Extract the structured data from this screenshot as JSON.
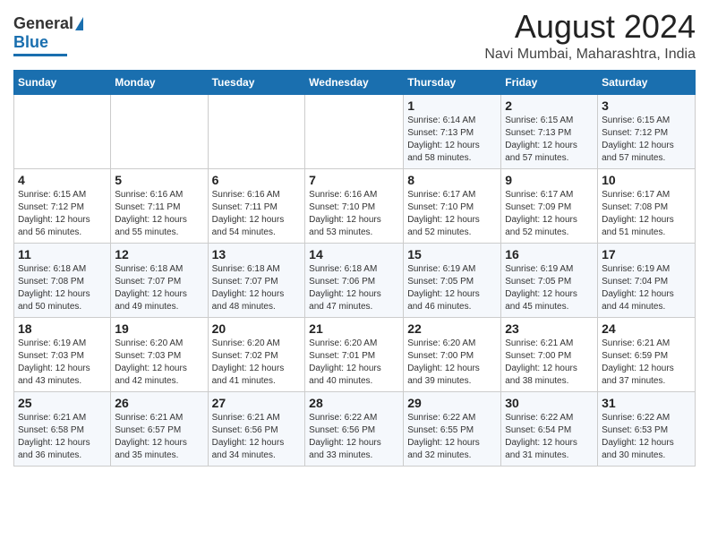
{
  "header": {
    "logo_general": "General",
    "logo_blue": "Blue",
    "main_title": "August 2024",
    "sub_title": "Navi Mumbai, Maharashtra, India"
  },
  "calendar": {
    "weekdays": [
      "Sunday",
      "Monday",
      "Tuesday",
      "Wednesday",
      "Thursday",
      "Friday",
      "Saturday"
    ],
    "weeks": [
      [
        {
          "day": "",
          "info": ""
        },
        {
          "day": "",
          "info": ""
        },
        {
          "day": "",
          "info": ""
        },
        {
          "day": "",
          "info": ""
        },
        {
          "day": "1",
          "info": "Sunrise: 6:14 AM\nSunset: 7:13 PM\nDaylight: 12 hours\nand 58 minutes."
        },
        {
          "day": "2",
          "info": "Sunrise: 6:15 AM\nSunset: 7:13 PM\nDaylight: 12 hours\nand 57 minutes."
        },
        {
          "day": "3",
          "info": "Sunrise: 6:15 AM\nSunset: 7:12 PM\nDaylight: 12 hours\nand 57 minutes."
        }
      ],
      [
        {
          "day": "4",
          "info": "Sunrise: 6:15 AM\nSunset: 7:12 PM\nDaylight: 12 hours\nand 56 minutes."
        },
        {
          "day": "5",
          "info": "Sunrise: 6:16 AM\nSunset: 7:11 PM\nDaylight: 12 hours\nand 55 minutes."
        },
        {
          "day": "6",
          "info": "Sunrise: 6:16 AM\nSunset: 7:11 PM\nDaylight: 12 hours\nand 54 minutes."
        },
        {
          "day": "7",
          "info": "Sunrise: 6:16 AM\nSunset: 7:10 PM\nDaylight: 12 hours\nand 53 minutes."
        },
        {
          "day": "8",
          "info": "Sunrise: 6:17 AM\nSunset: 7:10 PM\nDaylight: 12 hours\nand 52 minutes."
        },
        {
          "day": "9",
          "info": "Sunrise: 6:17 AM\nSunset: 7:09 PM\nDaylight: 12 hours\nand 52 minutes."
        },
        {
          "day": "10",
          "info": "Sunrise: 6:17 AM\nSunset: 7:08 PM\nDaylight: 12 hours\nand 51 minutes."
        }
      ],
      [
        {
          "day": "11",
          "info": "Sunrise: 6:18 AM\nSunset: 7:08 PM\nDaylight: 12 hours\nand 50 minutes."
        },
        {
          "day": "12",
          "info": "Sunrise: 6:18 AM\nSunset: 7:07 PM\nDaylight: 12 hours\nand 49 minutes."
        },
        {
          "day": "13",
          "info": "Sunrise: 6:18 AM\nSunset: 7:07 PM\nDaylight: 12 hours\nand 48 minutes."
        },
        {
          "day": "14",
          "info": "Sunrise: 6:18 AM\nSunset: 7:06 PM\nDaylight: 12 hours\nand 47 minutes."
        },
        {
          "day": "15",
          "info": "Sunrise: 6:19 AM\nSunset: 7:05 PM\nDaylight: 12 hours\nand 46 minutes."
        },
        {
          "day": "16",
          "info": "Sunrise: 6:19 AM\nSunset: 7:05 PM\nDaylight: 12 hours\nand 45 minutes."
        },
        {
          "day": "17",
          "info": "Sunrise: 6:19 AM\nSunset: 7:04 PM\nDaylight: 12 hours\nand 44 minutes."
        }
      ],
      [
        {
          "day": "18",
          "info": "Sunrise: 6:19 AM\nSunset: 7:03 PM\nDaylight: 12 hours\nand 43 minutes."
        },
        {
          "day": "19",
          "info": "Sunrise: 6:20 AM\nSunset: 7:03 PM\nDaylight: 12 hours\nand 42 minutes."
        },
        {
          "day": "20",
          "info": "Sunrise: 6:20 AM\nSunset: 7:02 PM\nDaylight: 12 hours\nand 41 minutes."
        },
        {
          "day": "21",
          "info": "Sunrise: 6:20 AM\nSunset: 7:01 PM\nDaylight: 12 hours\nand 40 minutes."
        },
        {
          "day": "22",
          "info": "Sunrise: 6:20 AM\nSunset: 7:00 PM\nDaylight: 12 hours\nand 39 minutes."
        },
        {
          "day": "23",
          "info": "Sunrise: 6:21 AM\nSunset: 7:00 PM\nDaylight: 12 hours\nand 38 minutes."
        },
        {
          "day": "24",
          "info": "Sunrise: 6:21 AM\nSunset: 6:59 PM\nDaylight: 12 hours\nand 37 minutes."
        }
      ],
      [
        {
          "day": "25",
          "info": "Sunrise: 6:21 AM\nSunset: 6:58 PM\nDaylight: 12 hours\nand 36 minutes."
        },
        {
          "day": "26",
          "info": "Sunrise: 6:21 AM\nSunset: 6:57 PM\nDaylight: 12 hours\nand 35 minutes."
        },
        {
          "day": "27",
          "info": "Sunrise: 6:21 AM\nSunset: 6:56 PM\nDaylight: 12 hours\nand 34 minutes."
        },
        {
          "day": "28",
          "info": "Sunrise: 6:22 AM\nSunset: 6:56 PM\nDaylight: 12 hours\nand 33 minutes."
        },
        {
          "day": "29",
          "info": "Sunrise: 6:22 AM\nSunset: 6:55 PM\nDaylight: 12 hours\nand 32 minutes."
        },
        {
          "day": "30",
          "info": "Sunrise: 6:22 AM\nSunset: 6:54 PM\nDaylight: 12 hours\nand 31 minutes."
        },
        {
          "day": "31",
          "info": "Sunrise: 6:22 AM\nSunset: 6:53 PM\nDaylight: 12 hours\nand 30 minutes."
        }
      ]
    ]
  }
}
